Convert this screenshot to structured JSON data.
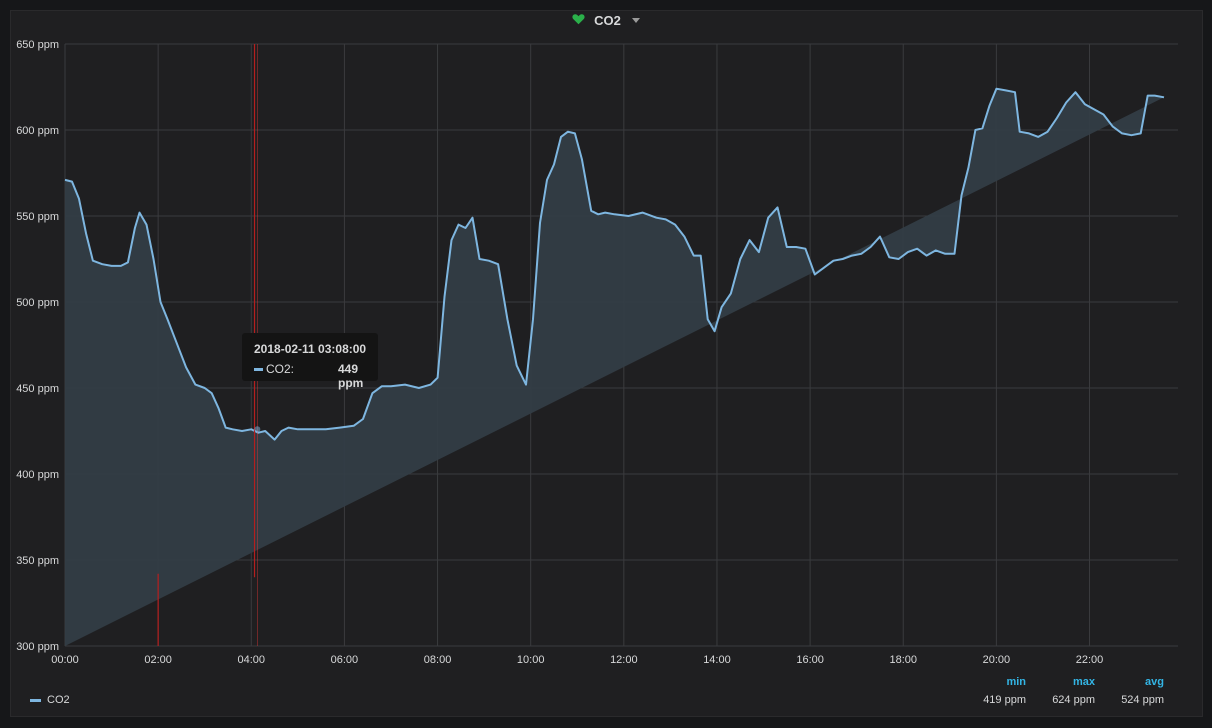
{
  "panel": {
    "title": "CO2",
    "icon": "heart-icon",
    "icon_color": "#2ab04a"
  },
  "colors": {
    "line": "#7eb6e0",
    "fill": "#333d46",
    "grid": "#3a3b3e",
    "alert_line": "#b51f1f",
    "legend_header": "#33b5e5"
  },
  "tooltip": {
    "time": "2018-02-11 03:08:00",
    "series_label": "CO2:",
    "value": "449 ppm"
  },
  "legend": {
    "series": "CO2",
    "headers": [
      "min",
      "max",
      "avg"
    ],
    "values": [
      "419 ppm",
      "624 ppm",
      "524 ppm"
    ]
  },
  "chart_data": {
    "type": "area",
    "title": "CO2",
    "unit": "ppm",
    "ylim": [
      300,
      650
    ],
    "yticks": [
      "300 ppm",
      "350 ppm",
      "400 ppm",
      "450 ppm",
      "500 ppm",
      "550 ppm",
      "600 ppm",
      "650 ppm"
    ],
    "xlim_hours": [
      0,
      23.9
    ],
    "xticks": [
      "00:00",
      "02:00",
      "04:00",
      "06:00",
      "08:00",
      "10:00",
      "12:00",
      "14:00",
      "16:00",
      "18:00",
      "20:00",
      "22:00"
    ],
    "grid": true,
    "legend_position": "bottom",
    "series": [
      {
        "name": "CO2",
        "x_hours": [
          0.0,
          0.15,
          0.3,
          0.45,
          0.6,
          0.8,
          1.0,
          1.2,
          1.35,
          1.5,
          1.6,
          1.75,
          1.9,
          2.05,
          2.2,
          2.4,
          2.6,
          2.8,
          3.0,
          3.15,
          3.3,
          3.45,
          3.6,
          3.8,
          4.0,
          4.15,
          4.3,
          4.5,
          4.65,
          4.8,
          5.0,
          5.3,
          5.6,
          5.9,
          6.2,
          6.4,
          6.6,
          6.8,
          7.0,
          7.3,
          7.6,
          7.85,
          8.0,
          8.15,
          8.3,
          8.45,
          8.6,
          8.75,
          8.9,
          9.1,
          9.3,
          9.5,
          9.7,
          9.9,
          10.05,
          10.2,
          10.35,
          10.5,
          10.65,
          10.8,
          10.95,
          11.1,
          11.3,
          11.45,
          11.6,
          11.8,
          12.1,
          12.4,
          12.7,
          12.9,
          13.1,
          13.3,
          13.5,
          13.65,
          13.8,
          13.95,
          14.1,
          14.3,
          14.5,
          14.7,
          14.9,
          15.1,
          15.3,
          15.5,
          15.7,
          15.9,
          16.1,
          16.3,
          16.5,
          16.7,
          16.9,
          17.1,
          17.3,
          17.5,
          17.7,
          17.9,
          18.1,
          18.3,
          18.5,
          18.7,
          18.9,
          19.1,
          19.25,
          19.4,
          19.55,
          19.7,
          19.85,
          20.0,
          20.2,
          20.4,
          20.5,
          20.7,
          20.9,
          21.1,
          21.3,
          21.5,
          21.7,
          21.9,
          22.1,
          22.3,
          22.5,
          22.7,
          22.9,
          23.1,
          23.25,
          23.4,
          23.6,
          23.9
        ],
        "values": [
          571,
          570,
          560,
          540,
          524,
          522,
          521,
          521,
          523,
          543,
          552,
          545,
          525,
          500,
          490,
          476,
          462,
          452,
          450,
          447,
          438,
          427,
          426,
          425,
          426,
          424,
          425,
          420,
          425,
          427,
          426,
          426,
          426,
          427,
          428,
          432,
          447,
          451,
          451,
          452,
          450,
          452,
          456,
          503,
          536,
          545,
          543,
          549,
          525,
          524,
          522,
          490,
          463,
          452,
          490,
          546,
          571,
          580,
          596,
          599,
          598,
          583,
          553,
          551,
          552,
          551,
          550,
          552,
          549,
          548,
          545,
          538,
          527,
          527,
          490,
          483,
          497,
          505,
          525,
          536,
          529,
          549,
          555,
          532,
          532,
          531,
          516,
          520,
          524,
          525,
          527,
          528,
          532,
          538,
          526,
          525,
          529,
          531,
          527,
          530,
          528,
          528,
          562,
          578,
          600,
          601,
          614,
          624,
          623,
          622,
          599,
          598,
          596,
          599,
          607,
          616,
          622,
          615,
          612,
          609,
          602,
          598,
          597,
          598,
          620,
          620,
          619
        ]
      }
    ],
    "annotations": [
      {
        "type": "alert",
        "x_hours": 2.0,
        "y_from": 300,
        "y_to": 342
      },
      {
        "type": "alert",
        "x_hours": 4.07,
        "y_from": 340,
        "y_to": 650
      },
      {
        "type": "hover",
        "x_hours": 4.13,
        "value": 449
      }
    ]
  }
}
